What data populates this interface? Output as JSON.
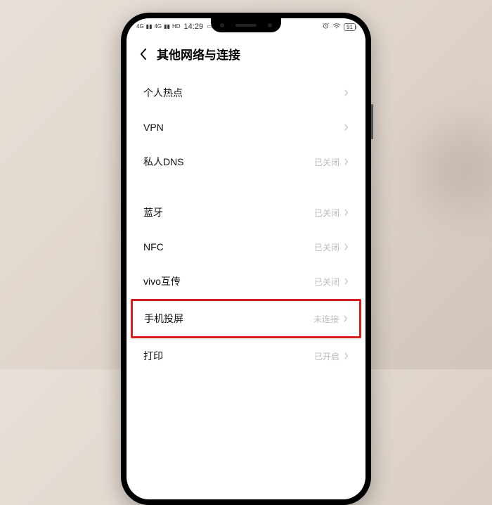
{
  "status_bar": {
    "signal1": "4G",
    "signal2": "4G",
    "hd": "HD",
    "time": "14:29",
    "battery": "91"
  },
  "header": {
    "title": "其他网络与连接"
  },
  "group1": [
    {
      "label": "个人热点",
      "value": ""
    },
    {
      "label": "VPN",
      "value": ""
    },
    {
      "label": "私人DNS",
      "value": "已关闭"
    }
  ],
  "group2": [
    {
      "label": "蓝牙",
      "value": "已关闭"
    },
    {
      "label": "NFC",
      "value": "已关闭"
    },
    {
      "label": "vivo互传",
      "value": "已关闭"
    },
    {
      "label": "手机投屏",
      "value": "未连接"
    },
    {
      "label": "打印",
      "value": "已开启"
    }
  ]
}
